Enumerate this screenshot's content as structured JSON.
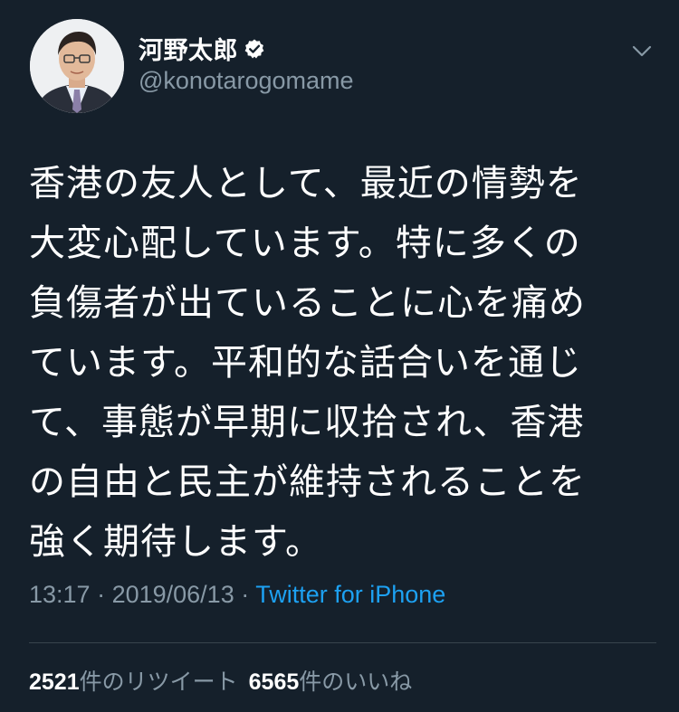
{
  "user": {
    "display_name": "河野太郎",
    "handle": "@konotarogomame",
    "verified": true,
    "avatar_icon": "profile-photo"
  },
  "tweet": {
    "text": "香港の友人として、最近の情勢を\n大変心配しています。特に多くの\n負傷者が出ていることに心を痛め\nています。平和的な話合いを通じ\nて、事態が早期に収拾され、香港\nの自由と民主が維持されることを\n強く期待します。",
    "time": "13:17",
    "separator1": " · ",
    "date": "2019/06/13",
    "separator2": " · ",
    "source": "Twitter for iPhone"
  },
  "stats": {
    "retweets_count": "2521",
    "retweets_label": "件のリツイート",
    "likes_count": "6565",
    "likes_label": "件のいいね"
  },
  "colors": {
    "background": "#15202b",
    "secondary_text": "#8899a6",
    "link": "#1da1f2",
    "divider": "#38444d"
  }
}
